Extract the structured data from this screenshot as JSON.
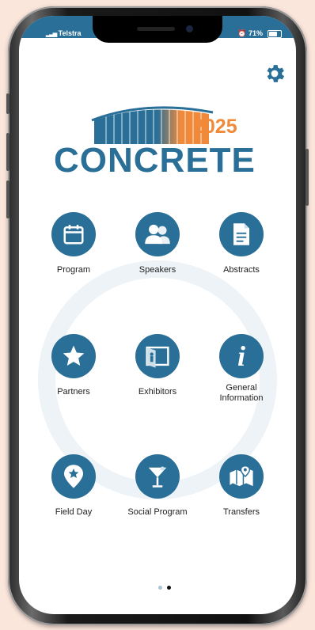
{
  "status_bar": {
    "carrier": "Telstra",
    "battery": "71%"
  },
  "logo": {
    "year": "2025",
    "word": "CONCRETE"
  },
  "tiles": [
    {
      "label": "Program"
    },
    {
      "label": "Speakers"
    },
    {
      "label": "Abstracts"
    },
    {
      "label": "Partners"
    },
    {
      "label": "Exhibitors"
    },
    {
      "label": "General\nInformation"
    },
    {
      "label": "Field Day"
    },
    {
      "label": "Social Program"
    },
    {
      "label": "Transfers"
    }
  ],
  "colors": {
    "accent": "#2a6f97",
    "logo_orange": "#f08a3a",
    "background": "#fbe6dc"
  },
  "page_indicator": {
    "pages": 2,
    "current": 2
  }
}
